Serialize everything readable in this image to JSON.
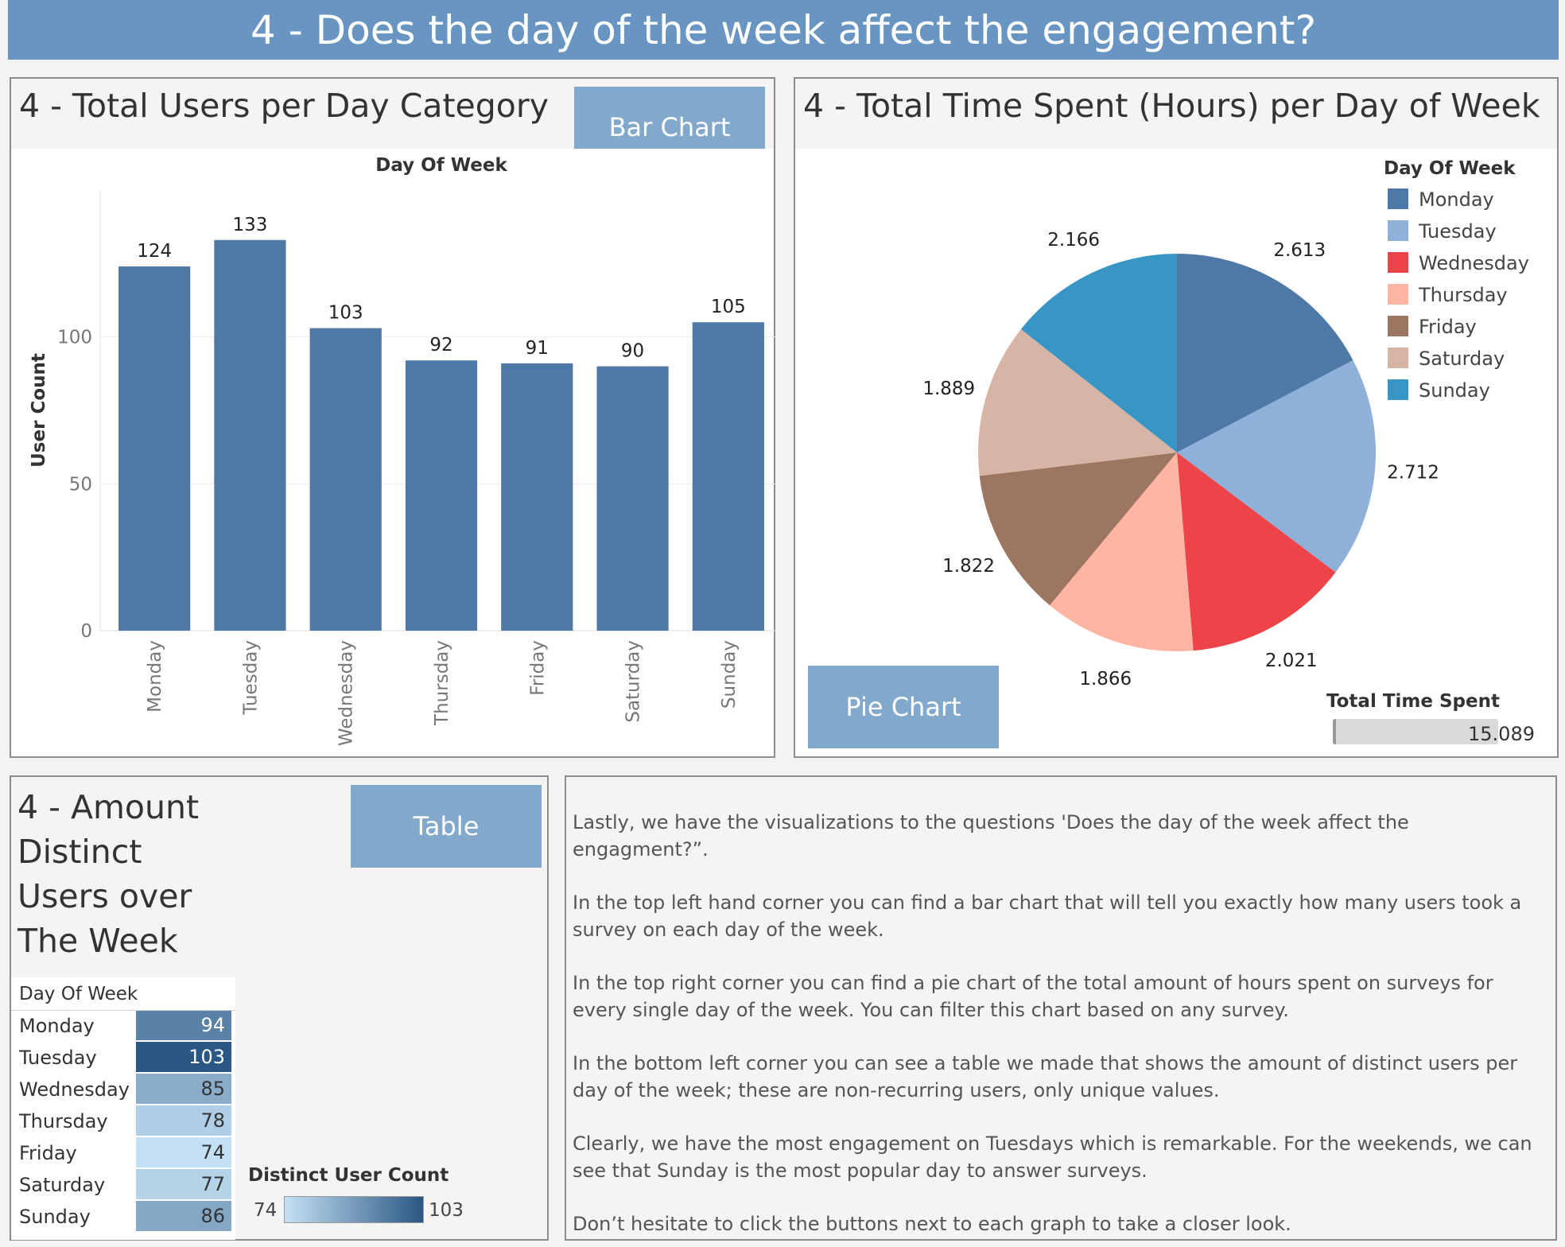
{
  "header": {
    "title": "4 - Does the day of the week affect the engagement?"
  },
  "bar_panel": {
    "title": "4 - Total Users per Day Category",
    "button": "Bar Chart",
    "column_header": "Day Of Week",
    "ylabel": "User Count"
  },
  "pie_panel": {
    "title": "4 - Total Time Spent (Hours) per Day of Week",
    "button": "Pie Chart",
    "legend_title": "Day Of Week",
    "total_label": "Total Time Spent",
    "total_value": "15.089"
  },
  "table_panel": {
    "title_lines": [
      "4 - Amount",
      "Distinct",
      "Users over",
      "The Week"
    ],
    "button": "Table",
    "column_header": "Day Of Week",
    "legend_title": "Distinct User Count",
    "legend_min": "74",
    "legend_max": "103"
  },
  "text_panel": {
    "paragraphs": [
      "Lastly, we have the visualizations to the questions 'Does the day of the week affect the engagment?”.",
      "In the top left hand corner you can find a bar chart that will tell you exactly how many users took a survey on each day of the week.",
      "In the top right corner you can find a pie chart of the total amount of hours spent on surveys for every single day of the week. You can filter this chart based on any survey.",
      "In the bottom left corner you can see a table we made that shows the amount of distinct users per day of the week; these are non-recurring users, only unique values.",
      "Clearly, we have the most engagement on Tuesdays which is remarkable. For the weekends, we can see that Sunday is the most popular day to answer surveys.",
      "Don’t hesitate to click the buttons next to each graph to take a closer look."
    ]
  },
  "chart_data": [
    {
      "type": "bar",
      "title": "4 - Total Users per Day Category",
      "xlabel": "Day Of Week",
      "ylabel": "User Count",
      "categories": [
        "Monday",
        "Tuesday",
        "Wednesday",
        "Thursday",
        "Friday",
        "Saturday",
        "Sunday"
      ],
      "values": [
        124,
        133,
        103,
        92,
        91,
        90,
        105
      ],
      "ylim": [
        0,
        150
      ],
      "yticks": [
        0,
        50,
        100
      ],
      "grid": true,
      "color": "#4e79a7"
    },
    {
      "type": "pie",
      "title": "4 - Total Time Spent (Hours) per Day of Week",
      "categories": [
        "Monday",
        "Tuesday",
        "Wednesday",
        "Thursday",
        "Friday",
        "Saturday",
        "Sunday"
      ],
      "values": [
        2.613,
        2.712,
        2.021,
        1.866,
        1.822,
        1.889,
        2.166
      ],
      "value_labels": [
        "2.613",
        "2.712",
        "2.021",
        "1.866",
        "1.822",
        "1.889",
        "2.166"
      ],
      "colors": [
        "#4e79a7",
        "#8fb1d9",
        "#ed444a",
        "#ffb5a1",
        "#9c7660",
        "#d7b5a6",
        "#3896c5"
      ],
      "legend": "top-right",
      "total": 15.089
    },
    {
      "type": "table",
      "title": "4 - Amount Distinct Users over The Week",
      "column": "Day Of Week",
      "rows": [
        {
          "day": "Monday",
          "value": 94
        },
        {
          "day": "Tuesday",
          "value": 103
        },
        {
          "day": "Wednesday",
          "value": 85
        },
        {
          "day": "Thursday",
          "value": 78
        },
        {
          "day": "Friday",
          "value": 74
        },
        {
          "day": "Saturday",
          "value": 77
        },
        {
          "day": "Sunday",
          "value": 86
        }
      ],
      "color_range": [
        74,
        103
      ],
      "color_low": "#c4e0f4",
      "color_high": "#2a5783"
    }
  ]
}
